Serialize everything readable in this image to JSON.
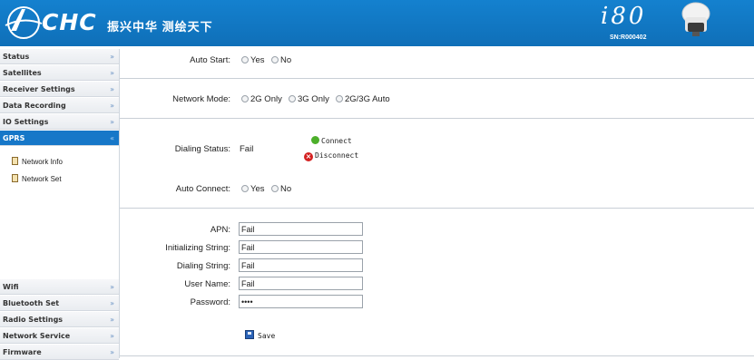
{
  "header": {
    "logo_text": "CHC",
    "slogan": "振兴中华  测绘天下",
    "model": "i80",
    "serial": "SN:R000402"
  },
  "sidebar": {
    "top_items": [
      {
        "label": "Status"
      },
      {
        "label": "Satellites"
      },
      {
        "label": "Receiver Settings"
      },
      {
        "label": "Data Recording"
      },
      {
        "label": "IO Settings"
      }
    ],
    "active_item": {
      "label": "GPRS"
    },
    "sub_items": [
      {
        "label": "Network Info"
      },
      {
        "label": "Network Set"
      }
    ],
    "bottom_items": [
      {
        "label": "Wifi"
      },
      {
        "label": "Bluetooth Set"
      },
      {
        "label": "Radio Settings"
      },
      {
        "label": "Network Service"
      },
      {
        "label": "Firmware"
      }
    ],
    "chevron": "»"
  },
  "form": {
    "auto_start": {
      "label": "Auto Start:",
      "options": [
        "Yes",
        "No"
      ]
    },
    "network_mode": {
      "label": "Network Mode:",
      "options": [
        "2G Only",
        "3G Only",
        "2G/3G Auto"
      ]
    },
    "dialing_status": {
      "label": "Dialing Status:",
      "value": "Fail"
    },
    "connect_label": "Connect",
    "disconnect_label": "Disconnect",
    "auto_connect": {
      "label": "Auto Connect:",
      "options": [
        "Yes",
        "No"
      ]
    },
    "fields": [
      {
        "label": "APN:",
        "value": "Fail"
      },
      {
        "label": "Initializing String:",
        "value": "Fail"
      },
      {
        "label": "Dialing String:",
        "value": "Fail"
      },
      {
        "label": "User Name:",
        "value": "Fail"
      },
      {
        "label": "Password:",
        "value": "••••"
      }
    ],
    "save_label": "Save"
  },
  "colors": {
    "header_blue": "#1079c4",
    "active_nav": "#1677c8"
  }
}
